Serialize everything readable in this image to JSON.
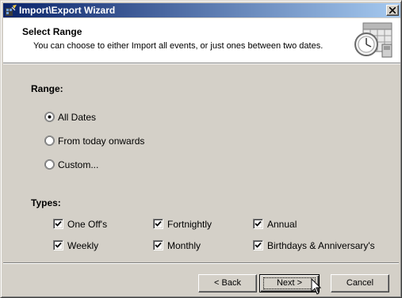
{
  "window": {
    "title": "Import\\Export Wizard",
    "title_bar_color": "#0a246a"
  },
  "header": {
    "title": "Select Range",
    "subtitle": "You can choose to either Import all events, or just ones between two dates.",
    "graphic_icon": "calendar-clock-icon"
  },
  "range": {
    "label": "Range:",
    "options": [
      {
        "label": "All Dates",
        "selected": true
      },
      {
        "label": "From today onwards",
        "selected": false
      },
      {
        "label": "Custom...",
        "selected": false
      }
    ]
  },
  "types": {
    "label": "Types:",
    "items": [
      {
        "label": "One Off's",
        "checked": true
      },
      {
        "label": "Fortnightly",
        "checked": true
      },
      {
        "label": "Annual",
        "checked": true
      },
      {
        "label": "Weekly",
        "checked": true
      },
      {
        "label": "Monthly",
        "checked": true
      },
      {
        "label": "Birthdays & Anniversary's",
        "checked": true
      }
    ]
  },
  "buttons": {
    "back": "< Back",
    "next": "Next >",
    "cancel": "Cancel"
  }
}
